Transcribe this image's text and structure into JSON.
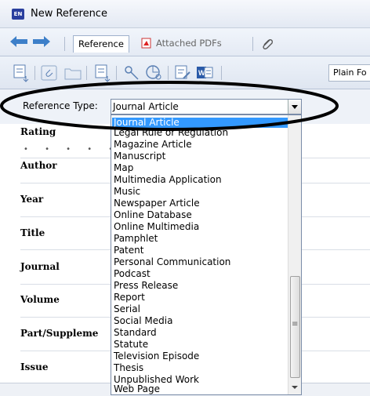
{
  "window": {
    "title": "New Reference",
    "app_badge": "EN"
  },
  "tabs": [
    {
      "label": "Reference"
    },
    {
      "label": "Attached PDFs"
    }
  ],
  "toolbar": {
    "font_value": "Plain Fo"
  },
  "reference_type": {
    "label": "Reference Type:",
    "selected": "Journal Article",
    "options": [
      "Journal Article",
      "Legal Rule or Regulation",
      "Magazine Article",
      "Manuscript",
      "Map",
      "Multimedia Application",
      "Music",
      "Newspaper Article",
      "Online Database",
      "Online Multimedia",
      "Pamphlet",
      "Patent",
      "Personal Communication",
      "Podcast",
      "Press Release",
      "Report",
      "Serial",
      "Social Media",
      "Standard",
      "Statute",
      "Television Episode",
      "Thesis",
      "Unpublished Work",
      "Web Page"
    ]
  },
  "fields": {
    "rating": "Rating",
    "author": "Author",
    "year": "Year",
    "title": "Title",
    "journal": "Journal",
    "volume": "Volume",
    "part": "Part/Suppleme",
    "issue": "Issue"
  },
  "colors": {
    "selection": "#3399ff",
    "annotation": "#000000"
  }
}
